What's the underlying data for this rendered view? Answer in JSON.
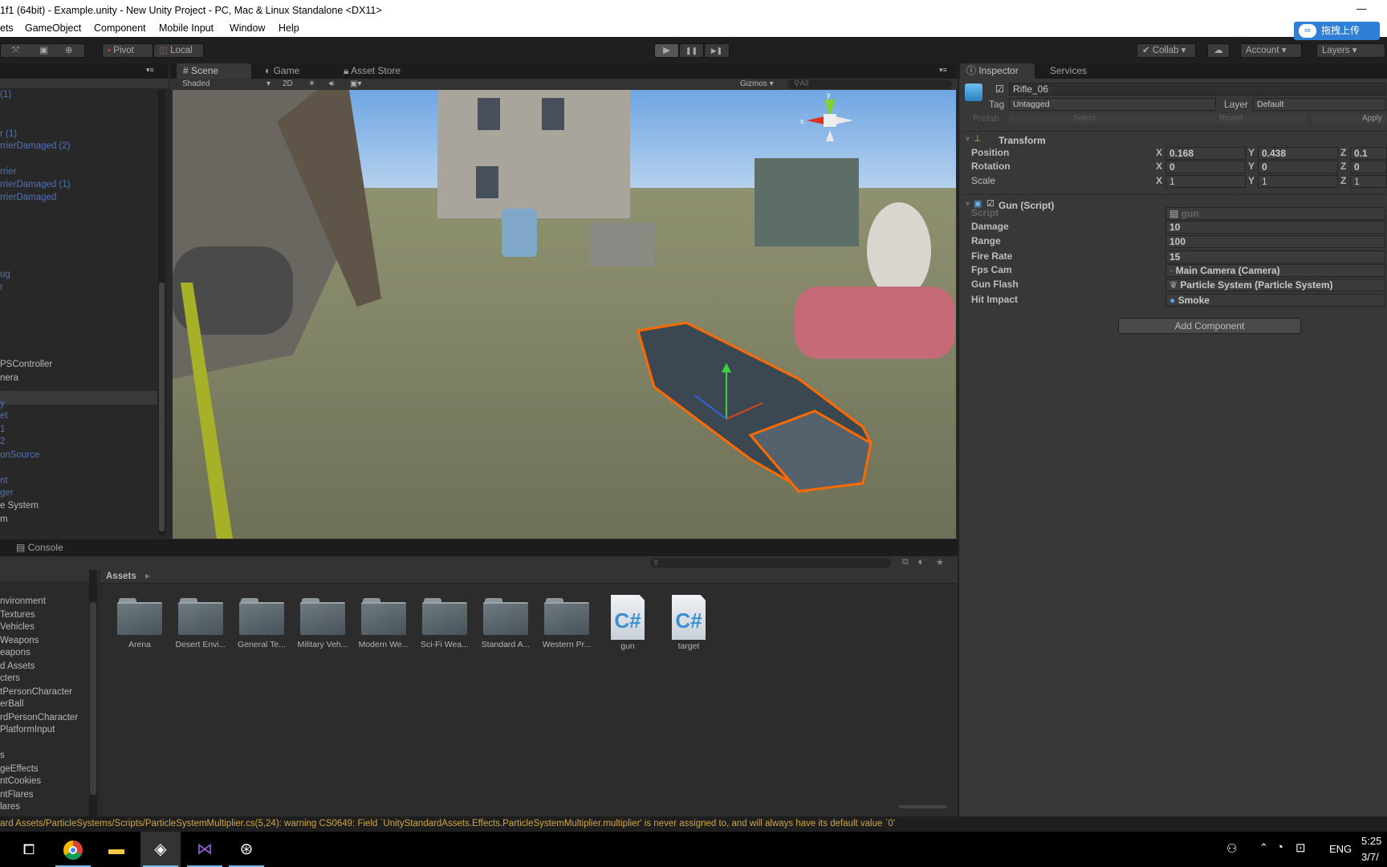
{
  "window": {
    "title": "1f1 (64bit) - Example.unity - New Unity Project - PC, Mac & Linux Standalone <DX11>",
    "minimize": "—"
  },
  "menu": [
    "ets",
    "GameObject",
    "Component",
    "Mobile Input",
    "Window",
    "Help"
  ],
  "toolbar": {
    "pivot": "Pivot",
    "local": "Local",
    "play": "▶",
    "pause": "❚❚",
    "step": "▶❚",
    "collab": "Collab",
    "account": "Account",
    "layers": "Layers"
  },
  "upload_badge": "拖拽上传",
  "hierarchy": {
    "items": [
      {
        "label": "(1)",
        "prefab": true
      },
      {
        "label": "r (1)",
        "prefab": true
      },
      {
        "label": "rrierDamaged (2)",
        "prefab": true
      },
      {
        "label": "rrier",
        "prefab": true
      },
      {
        "label": "rrierDamaged (1)",
        "prefab": true
      },
      {
        "label": "rrierDamaged",
        "prefab": true
      },
      {
        "label": "ug",
        "prefab": true
      },
      {
        "label": "r",
        "prefab": true
      },
      {
        "label": "PSController",
        "prefab": false
      },
      {
        "label": "nera",
        "prefab": false
      },
      {
        "label": "y",
        "prefab": true
      },
      {
        "label": "et",
        "prefab": true
      },
      {
        "label": "1",
        "prefab": true
      },
      {
        "label": "2",
        "prefab": true
      },
      {
        "label": "onSource",
        "prefab": true
      },
      {
        "label": "nt",
        "prefab": true
      },
      {
        "label": "ger",
        "prefab": true
      },
      {
        "label": "e System",
        "prefab": false
      },
      {
        "label": "m",
        "prefab": false
      }
    ]
  },
  "scene": {
    "tabs": [
      "Scene",
      "Game",
      "Asset Store"
    ],
    "shading": "Shaded",
    "mode_2d": "2D",
    "gizmos": "Gizmos",
    "search_placeholder": "All",
    "gizmo_axes": {
      "x": "x",
      "y": "y"
    }
  },
  "inspector": {
    "tabs": [
      "Inspector",
      "Services"
    ],
    "object_name": "Rifle_06",
    "active": true,
    "tag_label": "Tag",
    "tag": "Untagged",
    "layer_label": "Layer",
    "layer": "Default",
    "prefab_label": "Prefab",
    "prefab_select": "Select",
    "prefab_revert": "Revert",
    "prefab_apply": "Apply",
    "transform": {
      "title": "Transform",
      "rows": [
        {
          "label": "Position",
          "x": "0.168",
          "y": "0.438",
          "z": "0.1"
        },
        {
          "label": "Rotation",
          "x": "0",
          "y": "0",
          "z": "0"
        },
        {
          "label": "Scale",
          "x": "1",
          "y": "1",
          "z": "1"
        }
      ]
    },
    "gun_script": {
      "title": "Gun (Script)",
      "enabled": true,
      "rows": [
        {
          "label": "Script",
          "value": "gun"
        },
        {
          "label": "Damage",
          "value": "10"
        },
        {
          "label": "Range",
          "value": "100"
        },
        {
          "label": "Fire Rate",
          "value": "15"
        },
        {
          "label": "Fps Cam",
          "value": "Main Camera (Camera)"
        },
        {
          "label": "Gun Flash",
          "value": "Particle System (Particle System)"
        },
        {
          "label": "Hit Impact",
          "value": "Smoke"
        }
      ]
    },
    "add_component": "Add Component"
  },
  "project": {
    "tabs": [
      "Console"
    ],
    "breadcrumb": "Assets",
    "tree": [
      "nvironment",
      "Textures",
      "Vehicles",
      "Weapons",
      "eapons",
      "d Assets",
      "cters",
      "tPersonCharacter",
      "erBall",
      "rdPersonCharacter",
      "PlatformInput",
      "s",
      "geEffects",
      "ntCookies",
      "ntFlares",
      "lares"
    ],
    "assets": [
      {
        "name": "Arena",
        "type": "folder"
      },
      {
        "name": "Desert Envi...",
        "type": "folder"
      },
      {
        "name": "General Te...",
        "type": "folder"
      },
      {
        "name": "Military Veh...",
        "type": "folder"
      },
      {
        "name": "Modern We...",
        "type": "folder"
      },
      {
        "name": "Sci-Fi Wea...",
        "type": "folder"
      },
      {
        "name": "Standard A...",
        "type": "folder"
      },
      {
        "name": "Western Pr...",
        "type": "folder"
      },
      {
        "name": "gun",
        "type": "script"
      },
      {
        "name": "target",
        "type": "script"
      }
    ]
  },
  "status": "ard Assets/ParticleSystems/Scripts/ParticleSystemMultiplier.cs(5,24): warning CS0649: Field `UnityStandardAssets.Effects.ParticleSystemMultiplier.multiplier' is never assigned to, and will always have its default value `0'",
  "taskbar": {
    "apps": [
      "task-view",
      "chrome",
      "file-explorer",
      "unity",
      "visual-studio",
      "obs"
    ],
    "language": "ENG",
    "time": "5:25",
    "date": "3/7/"
  },
  "colors": {
    "prefab_text": "#4f72b8",
    "warning_text": "#d0a640",
    "selection_outline": "#ff6a00"
  }
}
